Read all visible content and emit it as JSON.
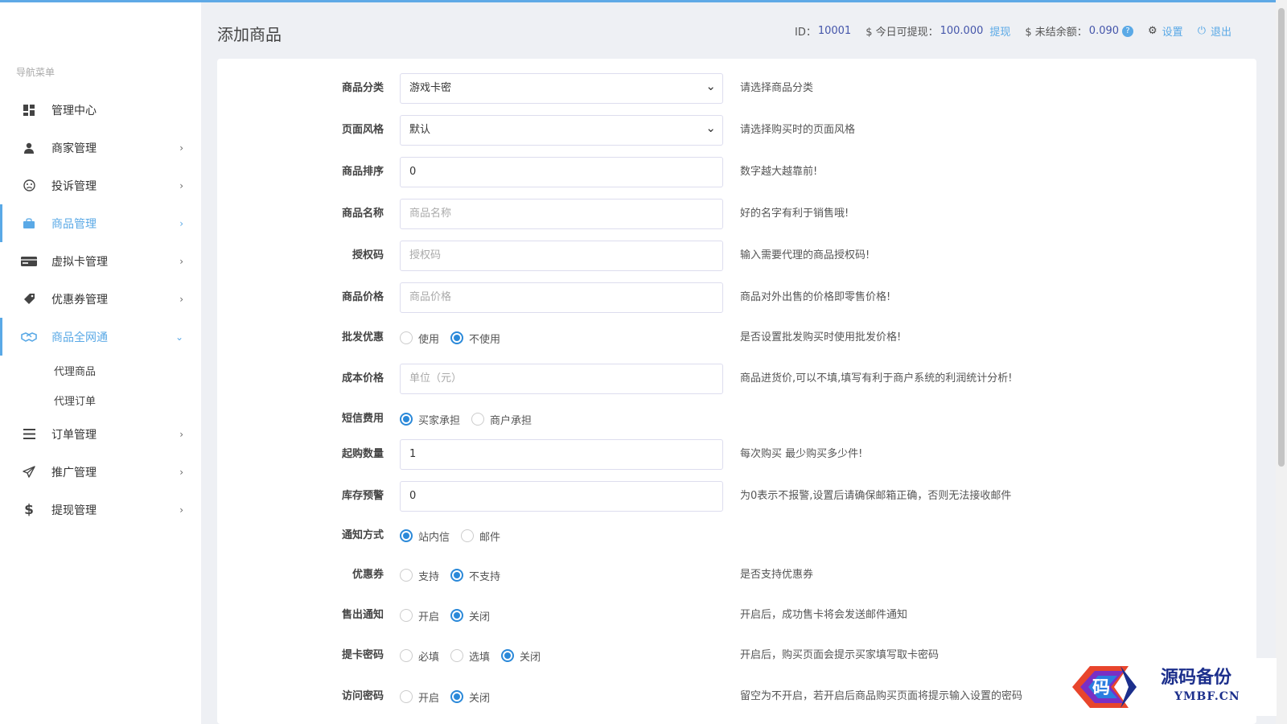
{
  "sidebar": {
    "nav_title": "导航菜单",
    "items": [
      {
        "label": "管理中心",
        "icon": "dashboard-icon",
        "arrow": ""
      },
      {
        "label": "商家管理",
        "icon": "user-icon",
        "arrow": "›"
      },
      {
        "label": "投诉管理",
        "icon": "frown-icon",
        "arrow": "›"
      },
      {
        "label": "商品管理",
        "icon": "shopping-bag-icon",
        "arrow": "›",
        "active": true
      },
      {
        "label": "虚拟卡管理",
        "icon": "card-icon",
        "arrow": "›"
      },
      {
        "label": "优惠券管理",
        "icon": "tag-icon",
        "arrow": "›"
      },
      {
        "label": "商品全网通",
        "icon": "handshake-icon",
        "arrow": "⌄",
        "active": true
      },
      {
        "label": "订单管理",
        "icon": "list-icon",
        "arrow": "›"
      },
      {
        "label": "推广管理",
        "icon": "paper-plane-icon",
        "arrow": "›"
      },
      {
        "label": "提现管理",
        "icon": "dollar-icon",
        "arrow": "›"
      }
    ],
    "subitems": [
      "代理商品",
      "代理订单"
    ]
  },
  "header": {
    "title": "添加商品",
    "id_label": "ID：",
    "id_value": "10001",
    "withdraw_label": "$ 今日可提现：",
    "withdraw_value": "100.000",
    "withdraw_link": "提现",
    "balance_label": "$ 未结余额：",
    "balance_value": "0.090",
    "help": "?",
    "settings": "设置",
    "logout": "退出"
  },
  "form": {
    "category": {
      "label": "商品分类",
      "value": "游戏卡密",
      "hint": "请选择商品分类"
    },
    "style": {
      "label": "页面风格",
      "value": "默认",
      "hint": "请选择购买时的页面风格"
    },
    "sort": {
      "label": "商品排序",
      "value": "0",
      "hint": "数字越大越靠前!"
    },
    "name": {
      "label": "商品名称",
      "placeholder": "商品名称",
      "hint": "好的名字有利于销售哦!"
    },
    "auth": {
      "label": "授权码",
      "placeholder": "授权码",
      "hint": "输入需要代理的商品授权码!"
    },
    "price": {
      "label": "商品价格",
      "placeholder": "商品价格",
      "hint": "商品对外出售的价格即零售价格!"
    },
    "wholesale": {
      "label": "批发优惠",
      "options": [
        "使用",
        "不使用"
      ],
      "selected": 1,
      "hint": "是否设置批发购买时使用批发价格!"
    },
    "cost": {
      "label": "成本价格",
      "placeholder": "单位（元）",
      "hint": "商品进货价,可以不填,填写有利于商户系统的利润统计分析!"
    },
    "sms": {
      "label": "短信费用",
      "options": [
        "买家承担",
        "商户承担"
      ],
      "selected": 0
    },
    "min_qty": {
      "label": "起购数量",
      "value": "1",
      "hint": "每次购买 最少购买多少件!"
    },
    "stock_alert": {
      "label": "库存预警",
      "value": "0",
      "hint": "为0表示不报警,设置后请确保邮箱正确，否则无法接收邮件"
    },
    "notify": {
      "label": "通知方式",
      "options": [
        "站内信",
        "邮件"
      ],
      "selected": 0
    },
    "coupon": {
      "label": "优惠券",
      "options": [
        "支持",
        "不支持"
      ],
      "selected": 1,
      "hint": "是否支持优惠券"
    },
    "sold_notice": {
      "label": "售出通知",
      "options": [
        "开启",
        "关闭"
      ],
      "selected": 1,
      "hint": "开启后，成功售卡将会发送邮件通知"
    },
    "card_pwd": {
      "label": "提卡密码",
      "options": [
        "必填",
        "选填",
        "关闭"
      ],
      "selected": 2,
      "hint": "开启后，购买页面会提示买家填写取卡密码"
    },
    "visit_pwd": {
      "label": "访问密码",
      "options": [
        "开启",
        "关闭"
      ],
      "selected": 1,
      "hint": "留空为不开启，若开启后商品购买页面将提示输入设置的密码"
    }
  },
  "watermark": {
    "title": "源码备份",
    "url": "YMBF.CN",
    "logo_char": "码"
  },
  "colors": {
    "accent": "#5aa9e6",
    "radio": "#2b89d9"
  }
}
